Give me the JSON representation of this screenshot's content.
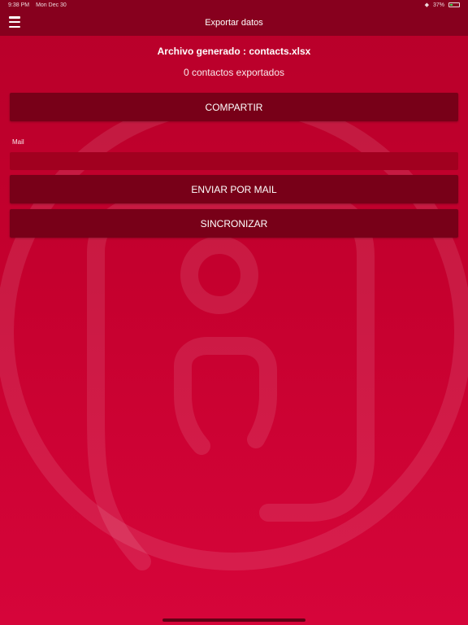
{
  "status_bar": {
    "time": "9:38 PM",
    "date": "Mon Dec 30",
    "battery_text": "37%"
  },
  "nav": {
    "title": "Exportar datos",
    "menu_icon": "hamburger-menu-icon"
  },
  "export": {
    "file_label": "Archivo generado : contacts.xlsx",
    "count_label": "0 contactos exportados"
  },
  "buttons": {
    "share": "COMPARTIR",
    "send_mail": "ENVIAR POR MAIL",
    "sync": "SINCRONIZAR"
  },
  "mail": {
    "label": "Mail",
    "value": "",
    "placeholder": ""
  },
  "colors": {
    "background_top": "#b8002a",
    "background_bottom": "#d6053a",
    "bar": "#87001e",
    "button": "#780018"
  }
}
